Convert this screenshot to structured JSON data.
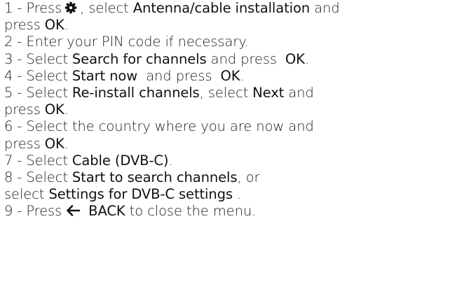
{
  "steps": [
    {
      "num": "1 -",
      "l1a": "Press",
      "l1b": ", select",
      "l1c": "Antenna/cable installation",
      "l1d": "and",
      "l2a": "press",
      "l2b": "OK",
      "l2c": "."
    },
    {
      "num": "2 -",
      "text": "Enter your PIN code if necessary."
    },
    {
      "num": "3 -",
      "a": "Select",
      "b": "Search for channels",
      "c": "and press",
      "d": "OK",
      "e": "."
    },
    {
      "num": "4 -",
      "a": "Select",
      "b": "Start now",
      "c": "and press",
      "d": "OK",
      "e": "."
    },
    {
      "num": "5 -",
      "a": "Select",
      "b": "Re-install channels",
      "c": ", select",
      "d": "Next",
      "e": "and",
      "l2a": "press",
      "l2b": "OK",
      "l2c": "."
    },
    {
      "num": "6 -",
      "a": "Select the country where you are now and",
      "l2a": "press",
      "l2b": "OK",
      "l2c": "."
    },
    {
      "num": "7 -",
      "a": "Select",
      "b": "Cable (DVB-C)",
      "c": "."
    },
    {
      "num": "8 -",
      "a": "Select",
      "b": "Start to search channels",
      "c": ", or",
      "l2a": "select",
      "l2b": "Settings for DVB-C settings",
      "l2c": "."
    },
    {
      "num": "9 -",
      "a": "Press",
      "b": "BACK",
      "c": "to close the menu."
    }
  ],
  "icons": {
    "settings": "gear-icon",
    "back": "back-arrow-icon"
  }
}
